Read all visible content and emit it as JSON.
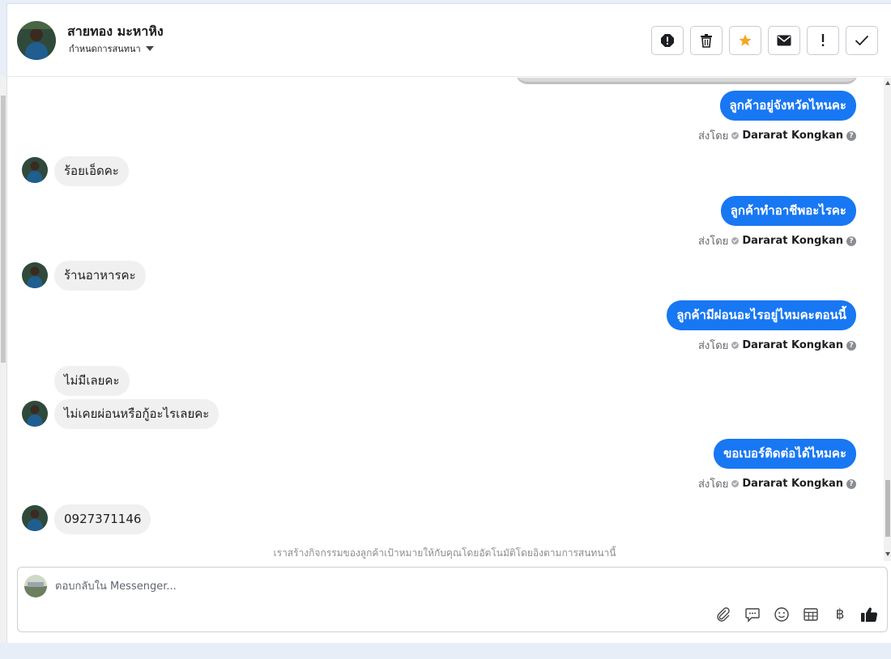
{
  "header": {
    "contact_name": "สายทอง มะหาหิง",
    "subtitle": "กำหนดการสนทนา"
  },
  "actions": [
    {
      "icon": "alert-octagon-icon"
    },
    {
      "icon": "trash-icon"
    },
    {
      "icon": "star-icon",
      "color": "#f5a623"
    },
    {
      "icon": "envelope-icon"
    },
    {
      "icon": "exclamation-icon"
    },
    {
      "icon": "check-icon"
    }
  ],
  "messages": {
    "sent_by_label": "ส่งโดย",
    "agent_name": "Dararat Kongkan",
    "help_glyph": "?",
    "outgoing": [
      {
        "text": "ลูกค้าอยู่จังหวัดไหนคะ"
      },
      {
        "text": "ลูกค้าทำอาชีพอะไรคะ"
      },
      {
        "text": "ลูกค้ามีผ่อนอะไรอยู่ไหมคะตอนนี้"
      },
      {
        "text": "ขอเบอร์ติดต่อได้ไหมคะ"
      }
    ],
    "incoming": [
      {
        "text": "ร้อยเอ็ดคะ"
      },
      {
        "text": "ร้านอาหารคะ"
      },
      {
        "text": "ไม่มีเลยคะ"
      },
      {
        "text": "ไม่เคยผ่อนหรือกู้อะไรเลยคะ"
      },
      {
        "text": "0927371146"
      }
    ],
    "auto_note": "เราสร้างกิจกรรมของลูกค้าเป้าหมายให้กับคุณโดยอัตโนมัติโดยอิงตามการสนทนานี้"
  },
  "composer": {
    "placeholder": "ตอบกลับใน Messenger...",
    "tools": [
      "paperclip-icon",
      "chat-bubble-icon",
      "smiley-icon",
      "table-icon",
      "baht-icon",
      "thumbs-up-icon"
    ],
    "baht_glyph": "฿"
  },
  "colors": {
    "outgoing_bubble": "#1877f2",
    "incoming_bubble": "#f0f0f0",
    "star": "#f5a623"
  }
}
